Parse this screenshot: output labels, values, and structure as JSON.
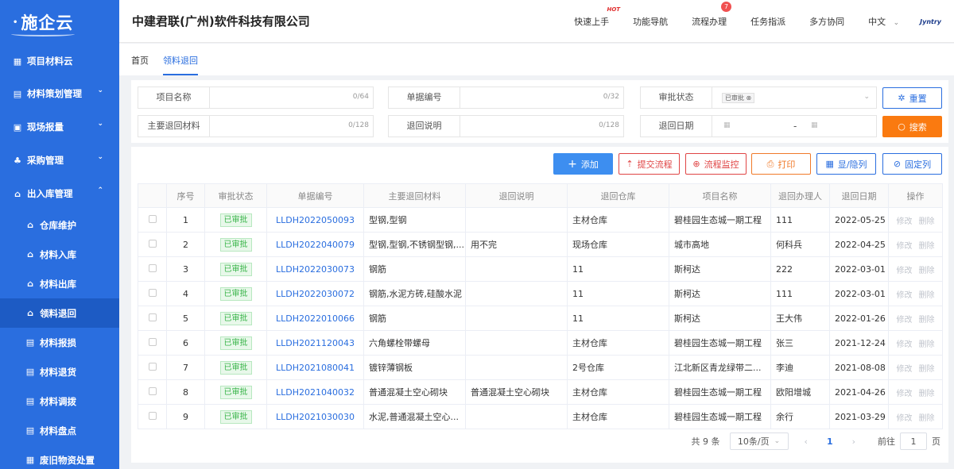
{
  "sidebar": {
    "logo": "施企云",
    "top": {
      "label": "项目材料云"
    },
    "groups": [
      {
        "label": "材料策划管理"
      },
      {
        "label": "现场报量"
      },
      {
        "label": "采购管理"
      },
      {
        "label": "出入库管理"
      }
    ],
    "subitems": [
      {
        "label": "仓库维护"
      },
      {
        "label": "材料入库"
      },
      {
        "label": "材料出库"
      },
      {
        "label": "领料退回"
      },
      {
        "label": "材料报损"
      },
      {
        "label": "材料退货"
      },
      {
        "label": "材料调拨"
      },
      {
        "label": "材料盘点"
      },
      {
        "label": "废旧物资处置"
      }
    ],
    "accent": "#2a6edf"
  },
  "header": {
    "company": "中建君联(广州)软件科技有限公司",
    "nav": {
      "quick": "快速上手",
      "hot": "HOT",
      "funcnav": "功能导航",
      "flow": "流程办理",
      "flow_badge": "7",
      "task": "任务指派",
      "collab": "多方协同",
      "lang": "中文",
      "brand": "Jyntry"
    }
  },
  "tabs": [
    {
      "label": "首页"
    },
    {
      "label": "领料退回"
    }
  ],
  "filters": {
    "project_name": {
      "label": "项目名称",
      "count": "0/64"
    },
    "doc_no": {
      "label": "单据编号",
      "count": "0/32"
    },
    "approval": {
      "label": "审批状态",
      "chip": "已审批"
    },
    "material": {
      "label": "主要退回材料",
      "count": "0/128"
    },
    "desc": {
      "label": "退回说明",
      "count": "0/128"
    },
    "date": {
      "label": "退回日期",
      "sep": "-"
    },
    "reset": "重置",
    "search": "搜索"
  },
  "toolbar": {
    "add": "添加",
    "submit": "提交流程",
    "monitor": "流程监控",
    "print": "打印",
    "toggle_cols": "显/隐列",
    "fix_cols": "固定列"
  },
  "table": {
    "headers": [
      "序号",
      "审批状态",
      "单据编号",
      "主要退回材料",
      "退回说明",
      "退回仓库",
      "项目名称",
      "退回办理人",
      "退回日期",
      "操作"
    ],
    "edit": "修改",
    "delete": "删除",
    "rows": [
      {
        "no": "1",
        "status": "已审批",
        "code": "LLDH2022050093",
        "material": "型钢,型钢",
        "desc": "",
        "warehouse": "主材仓库",
        "project": "碧桂园生态城一期工程",
        "handler": "111",
        "date": "2022-05-25"
      },
      {
        "no": "2",
        "status": "已审批",
        "code": "LLDH2022040079",
        "material": "型钢,型钢,不锈钢型钢,...",
        "desc": "用不完",
        "warehouse": "现场仓库",
        "project": "城市高地",
        "handler": "何科兵",
        "date": "2022-04-25"
      },
      {
        "no": "3",
        "status": "已审批",
        "code": "LLDH2022030073",
        "material": "钢筋",
        "desc": "",
        "warehouse": "11",
        "project": "斯柯达",
        "handler": "222",
        "date": "2022-03-01"
      },
      {
        "no": "4",
        "status": "已审批",
        "code": "LLDH2022030072",
        "material": "钢筋,水泥方砖,硅酸水泥",
        "desc": "",
        "warehouse": "11",
        "project": "斯柯达",
        "handler": "111",
        "date": "2022-03-01"
      },
      {
        "no": "5",
        "status": "已审批",
        "code": "LLDH2022010066",
        "material": "钢筋",
        "desc": "",
        "warehouse": "11",
        "project": "斯柯达",
        "handler": "王大伟",
        "date": "2022-01-26"
      },
      {
        "no": "6",
        "status": "已审批",
        "code": "LLDH2021120043",
        "material": "六角螺栓带螺母",
        "desc": "",
        "warehouse": "主材仓库",
        "project": "碧桂园生态城一期工程",
        "handler": "张三",
        "date": "2021-12-24"
      },
      {
        "no": "7",
        "status": "已审批",
        "code": "LLDH2021080041",
        "material": "镀锌薄钢板",
        "desc": "",
        "warehouse": "2号仓库",
        "project": "江北新区青龙绿带二...",
        "handler": "李迪",
        "date": "2021-08-08"
      },
      {
        "no": "8",
        "status": "已审批",
        "code": "LLDH2021040032",
        "material": "普通混凝土空心砌块",
        "desc": "普通混凝土空心砌块",
        "warehouse": "主材仓库",
        "project": "碧桂园生态城一期工程",
        "handler": "欧阳增城",
        "date": "2021-04-26"
      },
      {
        "no": "9",
        "status": "已审批",
        "code": "LLDH2021030030",
        "material": "水泥,普通混凝土空心...",
        "desc": "",
        "warehouse": "主材仓库",
        "project": "碧桂园生态城一期工程",
        "handler": "余行",
        "date": "2021-03-29"
      }
    ]
  },
  "pager": {
    "total": "共 9 条",
    "page_size": "10条/页",
    "current": "1",
    "goto": "前往",
    "goto_value": "1",
    "page_suffix": "页"
  }
}
